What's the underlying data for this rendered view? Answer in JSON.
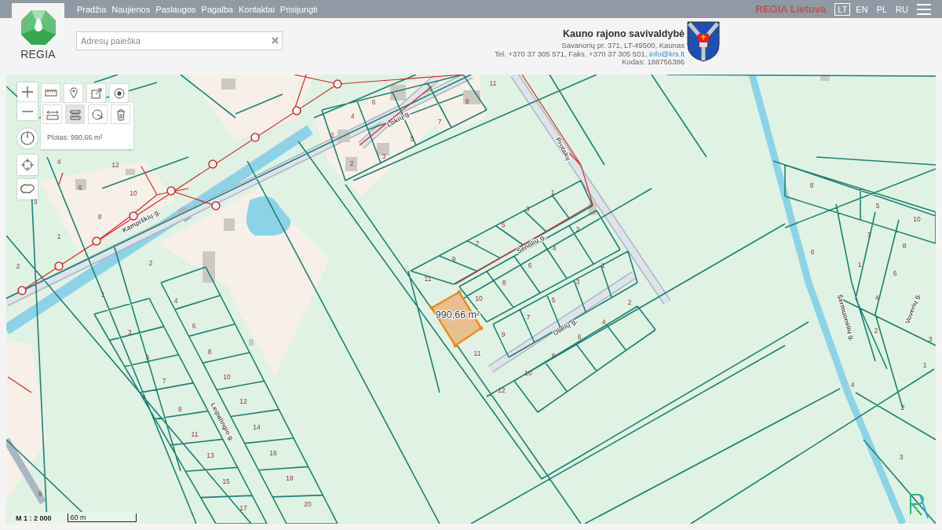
{
  "top_bar": {
    "nav": [
      "Pradžia",
      "Naujienos",
      "Paslaugos",
      "Pagalba",
      "Kontaktai",
      "Prisijungti"
    ],
    "brand": "REGIA Lietuva",
    "languages": [
      {
        "label": "LT",
        "selected": true
      },
      {
        "label": "EN",
        "selected": false
      },
      {
        "label": "PL",
        "selected": false
      },
      {
        "label": "RU",
        "selected": false
      }
    ]
  },
  "logo": {
    "text": "REGIA"
  },
  "search": {
    "placeholder": "Adresų paieška"
  },
  "municipality": {
    "name": "Kauno rajono savivaldybė",
    "address": "Savanorių pr. 371, LT-49500, Kaunas",
    "contacts": "Tel. +370 37 305 571, Faks. +370 37 305 501, ",
    "email": "info@krs.lt",
    "code": "Kodas: 188756386"
  },
  "map": {
    "tools": [
      {
        "kind": "ruler"
      },
      {
        "kind": "marker"
      },
      {
        "kind": "export"
      },
      {
        "kind": "point"
      }
    ],
    "measure_tools": [
      {
        "kind": "distance",
        "selected": false
      },
      {
        "kind": "area",
        "selected": true
      },
      {
        "kind": "reset",
        "selected": false
      },
      {
        "kind": "delete",
        "selected": false
      }
    ],
    "measurement": "Plotas: 990,66 m²",
    "area_label": "990,66 m²",
    "streets": [
      "Kampiškių g.",
      "Lokių g.",
      "Protakų",
      "Senolių g.",
      "Obelų g.",
      "Leipalingio g.",
      "Šermuonėlių g.",
      "Voverių g."
    ],
    "parcels": [
      "4",
      "12",
      "6",
      "10",
      "3",
      "8",
      "1",
      "2",
      "2",
      "1",
      "4",
      "3",
      "6",
      "5",
      "8",
      "7",
      "10",
      "9",
      "12",
      "11",
      "14",
      "13",
      "16",
      "15",
      "18",
      "17",
      "20",
      "9",
      "11",
      "6",
      "4",
      "7",
      "2",
      "5",
      "3",
      "2",
      "9",
      "1",
      "3",
      "5",
      "2",
      "7",
      "4",
      "9",
      "6",
      "1",
      "11",
      "8",
      "3",
      "10",
      "5",
      "7",
      "2",
      "9",
      "4",
      "6",
      "11",
      "8",
      "10",
      "12",
      "8",
      "5",
      "10",
      "3",
      "8",
      "6",
      "1",
      "6",
      "4",
      "2",
      "3",
      "1",
      "4",
      "2",
      "3"
    ],
    "scale": "M 1 : 2 000",
    "scale_bar": "60 m"
  }
}
